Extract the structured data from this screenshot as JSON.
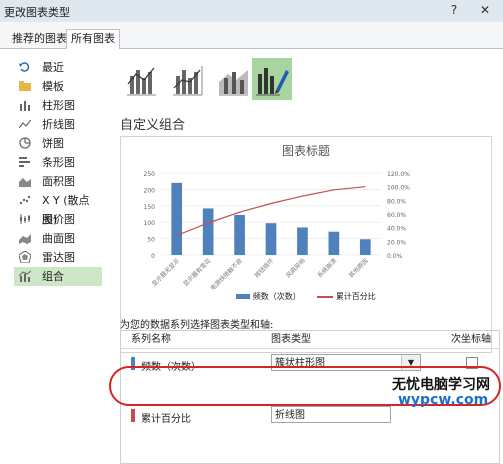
{
  "window": {
    "title": "更改图表类型",
    "help_label": "?",
    "close_label": "✕"
  },
  "tabs": [
    {
      "label": "推荐的图表",
      "active": false
    },
    {
      "label": "所有图表",
      "active": true
    }
  ],
  "sidebar": {
    "items": [
      {
        "label": "最近",
        "icon": "recent-icon",
        "active": false
      },
      {
        "label": "模板",
        "icon": "folder-icon",
        "active": false
      },
      {
        "label": "柱形图",
        "icon": "column-chart-icon",
        "active": false
      },
      {
        "label": "折线图",
        "icon": "line-chart-icon",
        "active": false
      },
      {
        "label": "饼图",
        "icon": "pie-chart-icon",
        "active": false
      },
      {
        "label": "条形图",
        "icon": "bar-chart-icon",
        "active": false
      },
      {
        "label": "面积图",
        "icon": "area-chart-icon",
        "active": false
      },
      {
        "label": "X Y (散点图)",
        "icon": "scatter-chart-icon",
        "active": false
      },
      {
        "label": "股价图",
        "icon": "stock-chart-icon",
        "active": false
      },
      {
        "label": "曲面图",
        "icon": "surface-chart-icon",
        "active": false
      },
      {
        "label": "雷达图",
        "icon": "radar-chart-icon",
        "active": false
      },
      {
        "label": "组合",
        "icon": "combo-chart-icon",
        "active": true
      }
    ]
  },
  "combo_types": [
    {
      "icon": "clustered-column-line-icon",
      "active": false
    },
    {
      "icon": "clustered-column-line-secondary-icon",
      "active": false
    },
    {
      "icon": "stacked-area-column-icon",
      "active": false
    },
    {
      "icon": "custom-combination-icon",
      "active": true
    }
  ],
  "section_title": "自定义组合",
  "chart_data": {
    "type": "bar",
    "title": "图表标题",
    "categories": [
      "显示器无显示",
      "显示器有雪花",
      "电源线接触不良",
      "按钮损坏",
      "风扇异响",
      "系统崩溃",
      "其他原因"
    ],
    "series": [
      {
        "name": "频数（次数）",
        "type": "bar",
        "axis": "primary",
        "color": "#4f81bd",
        "values": [
          220,
          142,
          122,
          97,
          84,
          71,
          48
        ]
      },
      {
        "name": "累计百分比",
        "type": "line",
        "axis": "secondary",
        "color": "#c0504d",
        "values": [
          28.5,
          46.9,
          62.7,
          75.3,
          86.2,
          95.4,
          100.0
        ]
      }
    ],
    "primary_axis": {
      "ylim": [
        0,
        250
      ],
      "ticks": [
        "0",
        "50",
        "100",
        "150",
        "200",
        "250"
      ]
    },
    "secondary_axis": {
      "ylim": [
        0,
        120
      ],
      "ticks": [
        "0.0%",
        "20.0%",
        "40.0%",
        "60.0%",
        "80.0%",
        "100.0%",
        "120.0%"
      ]
    },
    "legend_position": "bottom",
    "legend": [
      {
        "label": "频数（次数）",
        "color": "#4f81bd",
        "kind": "bar"
      },
      {
        "label": "累计百分比",
        "color": "#c0504d",
        "kind": "line"
      }
    ]
  },
  "series_prompt": "为您的数据系列选择图表类型和轴:",
  "grid": {
    "headers": {
      "name": "系列名称",
      "type": "图表类型",
      "axis": "次坐标轴"
    },
    "rows": [
      {
        "name": "频数（次数）",
        "color": "#4f81bd",
        "chart_type": "簇状柱形图",
        "secondary_axis": false
      },
      {
        "name": "累计百分比",
        "color": "#c0504d",
        "chart_type": "折线图",
        "secondary_axis": true
      }
    ]
  },
  "watermark": {
    "line1": "无忧电脑学习网",
    "line2": "wypcw.com"
  }
}
